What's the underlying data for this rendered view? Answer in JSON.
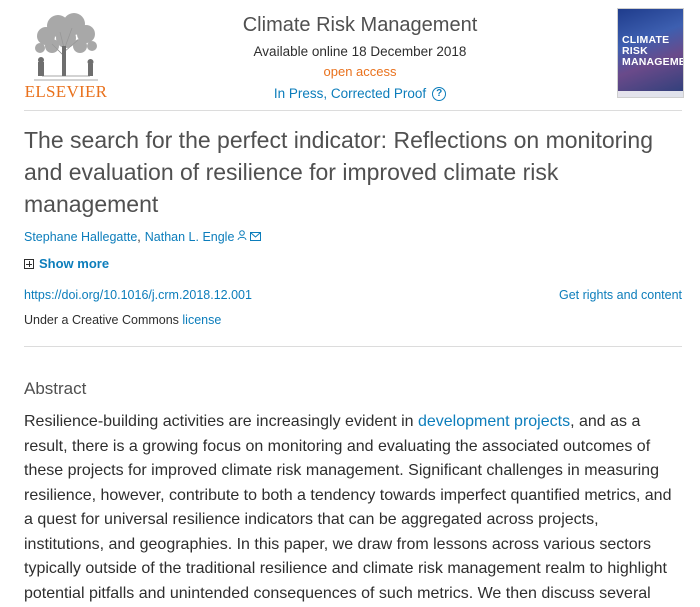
{
  "header": {
    "publisher_logo_text": "ELSEVIER",
    "journal_title": "Climate Risk Management",
    "available_online": "Available online 18 December 2018",
    "access_type": "open access",
    "status": "In Press, Corrected Proof",
    "help_icon": "?",
    "cover_title": "CLIMATE RISK MANAGEMENT"
  },
  "article": {
    "title": "The search for the perfect indicator: Reflections on monitoring and evaluation of resilience for improved climate risk management",
    "authors": [
      {
        "name": "Stephane Hallegatte",
        "separator": ","
      },
      {
        "name": "Nathan L. Engle",
        "separator": ""
      }
    ],
    "show_more_label": "Show more",
    "doi_link": "https://doi.org/10.1016/j.crm.2018.12.001",
    "rights_link": "Get rights and content",
    "license_prefix": "Under a Creative Commons",
    "license_link": "license"
  },
  "abstract": {
    "heading": "Abstract",
    "text_before_link": "Resilience-building activities are increasingly evident in ",
    "link_text": "development projects",
    "text_after_link": ", and as a result, there is a growing focus on monitoring and evaluating the associated outcomes of these projects for improved climate risk management. Significant challenges in measuring resilience, however, contribute to both a tendency towards imperfect quantified metrics, and a quest for universal resilience indicators that can be aggregated across projects, institutions, and geographies. In this paper, we draw from lessons across various sectors typically outside of the traditional resilience and climate risk management realm to highlight potential pitfalls and unintended consequences of such metrics. We then discuss several"
  },
  "colors": {
    "link_blue": "#0c7dbb",
    "elsevier_orange": "#e9711c",
    "title_gray": "#505050"
  },
  "icons": [
    "elsevier-tree-logo",
    "help-circle-icon",
    "person-icon",
    "mail-icon",
    "plus-box-icon"
  ]
}
